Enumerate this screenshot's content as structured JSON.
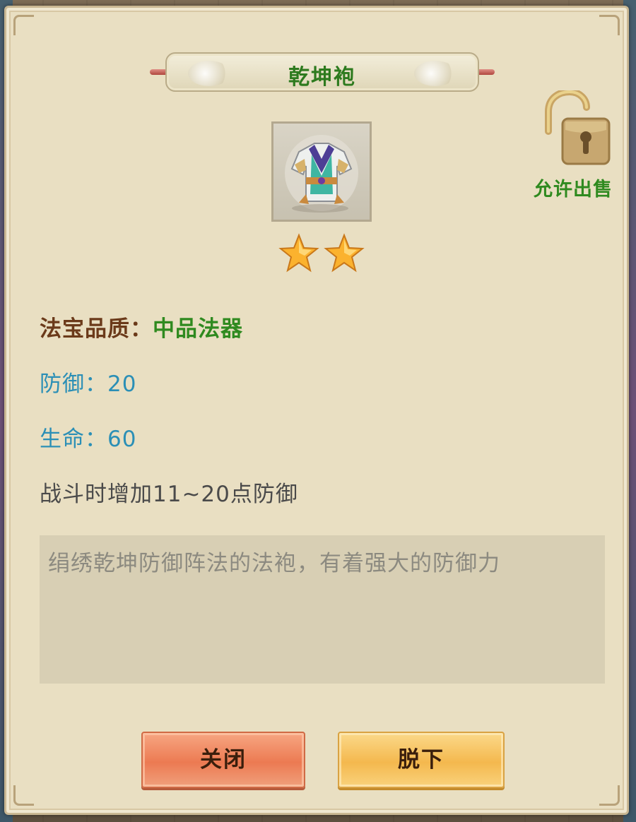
{
  "dialog": {
    "title": "乾坤袍",
    "sale_status_label": "允许出售",
    "item_icon": "armor-robe-icon",
    "star_count": 2,
    "quality_label": "法宝品质：",
    "quality_value": "中品法器",
    "defense_text": "防御：20",
    "life_text": "生命：60",
    "effect_text": "战斗时增加11~20点防御",
    "description": "绢绣乾坤防御阵法的法袍，有着强大的防御力"
  },
  "buttons": {
    "close_label": "关闭",
    "remove_label": "脱下"
  },
  "colors": {
    "title_green": "#2d7a1e",
    "stat_blue": "#2b8fb6",
    "quality_brown": "#6b3a1a",
    "close_button": "#ec7a52",
    "remove_button": "#f4b84e"
  }
}
